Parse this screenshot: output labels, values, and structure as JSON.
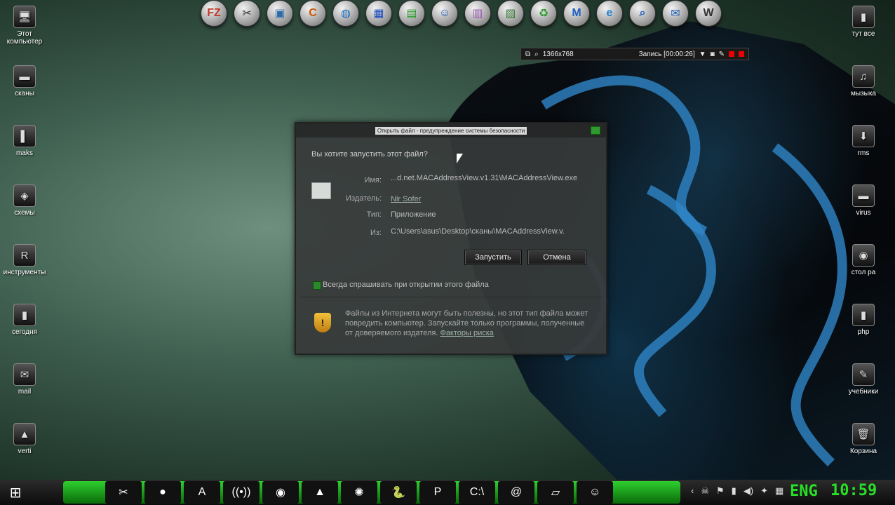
{
  "desktop_left": [
    {
      "label": "Этот компьютер",
      "icon": "computer-icon",
      "glyph": "🖥"
    },
    {
      "label": "сканы",
      "icon": "folder-icon",
      "glyph": "▬"
    },
    {
      "label": "maks",
      "icon": "folder-icon",
      "glyph": "▌"
    },
    {
      "label": "схемы",
      "icon": "folder-icon",
      "glyph": "◈"
    },
    {
      "label": "инструменты",
      "icon": "folder-icon",
      "glyph": "R"
    },
    {
      "label": "сегодня",
      "icon": "folder-icon",
      "glyph": "▮"
    },
    {
      "label": "mail",
      "icon": "folder-icon",
      "glyph": "✉"
    },
    {
      "label": "verti",
      "icon": "folder-icon",
      "glyph": "▲"
    }
  ],
  "desktop_right": [
    {
      "label": "тут все",
      "icon": "folder-icon",
      "glyph": "▮"
    },
    {
      "label": "мызыка",
      "icon": "folder-icon",
      "glyph": "♫"
    },
    {
      "label": "rms",
      "icon": "folder-icon",
      "glyph": "⬇"
    },
    {
      "label": "virus",
      "icon": "folder-icon",
      "glyph": "▬"
    },
    {
      "label": "стол ра",
      "icon": "folder-icon",
      "glyph": "◉"
    },
    {
      "label": "php",
      "icon": "folder-icon",
      "glyph": "▮"
    },
    {
      "label": "учебники",
      "icon": "folder-icon",
      "glyph": "✎"
    },
    {
      "label": "Корзина",
      "icon": "recycle-bin-icon",
      "glyph": "🗑"
    }
  ],
  "top_dock": [
    {
      "icon": "filezilla-icon",
      "glyph": "FZ",
      "color": "#c0392b"
    },
    {
      "icon": "tools-icon",
      "glyph": "✂",
      "color": "#333"
    },
    {
      "icon": "monitor-icon",
      "glyph": "▣",
      "color": "#2d6aa8"
    },
    {
      "icon": "ccleaner-icon",
      "glyph": "C",
      "color": "#d35400"
    },
    {
      "icon": "globe-icon",
      "glyph": "◍",
      "color": "#1f6fbf"
    },
    {
      "icon": "maze-icon",
      "glyph": "▦",
      "color": "#1f4fbf"
    },
    {
      "icon": "network-icon",
      "glyph": "▤",
      "color": "#2b9b2b"
    },
    {
      "icon": "mask-icon",
      "glyph": "☺",
      "color": "#1f5fbf"
    },
    {
      "icon": "winrar-icon",
      "glyph": "▥",
      "color": "#9b59b6"
    },
    {
      "icon": "photo-icon",
      "glyph": "▨",
      "color": "#3b7a3b"
    },
    {
      "icon": "recycle-icon",
      "glyph": "♻",
      "color": "#2b9b2b"
    },
    {
      "icon": "logo-icon",
      "glyph": "M",
      "color": "#1f5fbf"
    },
    {
      "icon": "ie-icon",
      "glyph": "e",
      "color": "#1f7fd0"
    },
    {
      "icon": "search-icon",
      "glyph": "⌕",
      "color": "#1f5fbf"
    },
    {
      "icon": "mail-icon",
      "glyph": "✉",
      "color": "#1f5fbf"
    },
    {
      "icon": "tank-icon",
      "glyph": "W",
      "color": "#333"
    }
  ],
  "rec_bar": {
    "resolution": "1366x768",
    "record_label": "Запись [00:00:26]"
  },
  "dialog": {
    "title": "Открыть файл - предупреждение системы безопасности",
    "question": "Вы хотите запустить этот файл?",
    "name_label": "Имя:",
    "name_value": "...d.net.MACAddressView.v1.31\\MACAddressView.exe",
    "publisher_label": "Издатель:",
    "publisher_value": "Nir Sofer",
    "type_label": "Тип:",
    "type_value": "Приложение",
    "from_label": "Из:",
    "from_value": "C:\\Users\\asus\\Desktop\\сканы\\MACAddressView.v.",
    "run_label": "Запустить",
    "cancel_label": "Отмена",
    "checkbox_label": "Всегда спрашивать при открытии этого файла",
    "warning_text": "Файлы из Интернета могут быть полезны, но этот тип файла может повредить компьютер. Запускайте только программы, полученные от доверяемого издателя.",
    "risk_link": "Факторы риска"
  },
  "taskbar": {
    "items": [
      {
        "icon": "scissors-icon",
        "glyph": "✂"
      },
      {
        "icon": "record-icon",
        "glyph": "●"
      },
      {
        "icon": "font-icon",
        "glyph": "A"
      },
      {
        "icon": "wifi-icon",
        "glyph": "((•))"
      },
      {
        "icon": "chrome-icon",
        "glyph": "◉"
      },
      {
        "icon": "avast-icon",
        "glyph": "▲"
      },
      {
        "icon": "ball-icon",
        "glyph": "✺"
      },
      {
        "icon": "python-icon",
        "glyph": "🐍"
      },
      {
        "icon": "paint-icon",
        "glyph": "P"
      },
      {
        "icon": "terminal-icon",
        "glyph": "C:\\"
      },
      {
        "icon": "at-icon",
        "glyph": "@"
      },
      {
        "icon": "notes-icon",
        "glyph": "▱"
      },
      {
        "icon": "mask-icon",
        "glyph": "☺"
      }
    ],
    "tray": [
      "‹",
      "☠",
      "⚑",
      "▮",
      "◀)",
      "✦",
      "▦"
    ],
    "language": "ENG",
    "clock": "10:59"
  }
}
